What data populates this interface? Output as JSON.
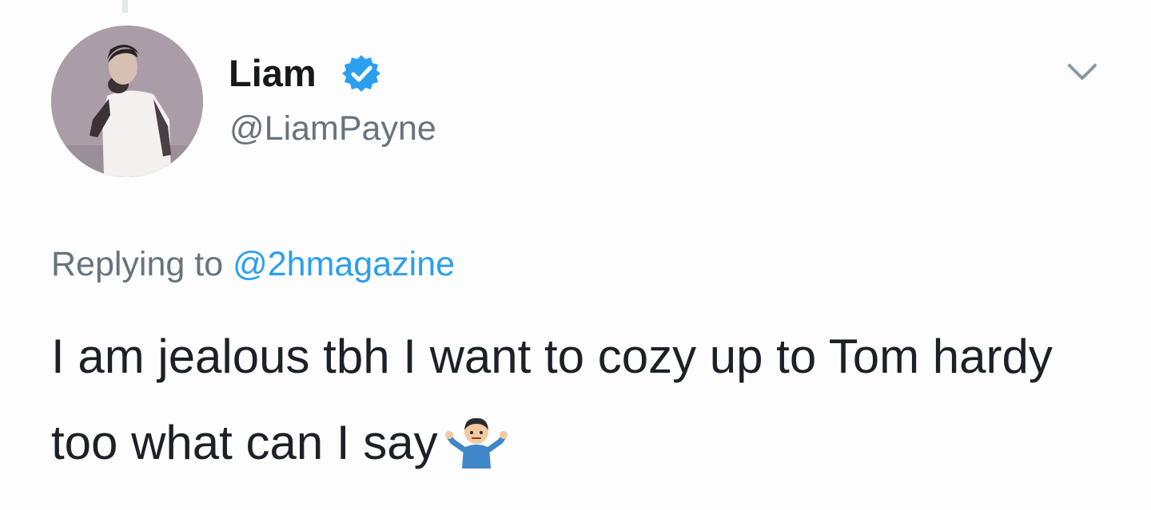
{
  "author": {
    "display_name": "Liam",
    "handle": "@LiamPayne",
    "avatar_icon": "profile-photo",
    "verified_icon": "verified-badge-icon"
  },
  "reply": {
    "prefix": "Replying to",
    "mention": "@2hmagazine"
  },
  "tweet": {
    "text": "I am jealous tbh I want to cozy up to Tom hardy too what can I say",
    "emoji": "man-shrugging-emoji"
  },
  "menu": {
    "icon": "chevron-down-icon"
  },
  "colors": {
    "link": "#2a9ff0",
    "verified": "#2a9ff0",
    "muted_text": "#67737d",
    "body_text": "#1c2127",
    "background": "#fdfdfe"
  }
}
